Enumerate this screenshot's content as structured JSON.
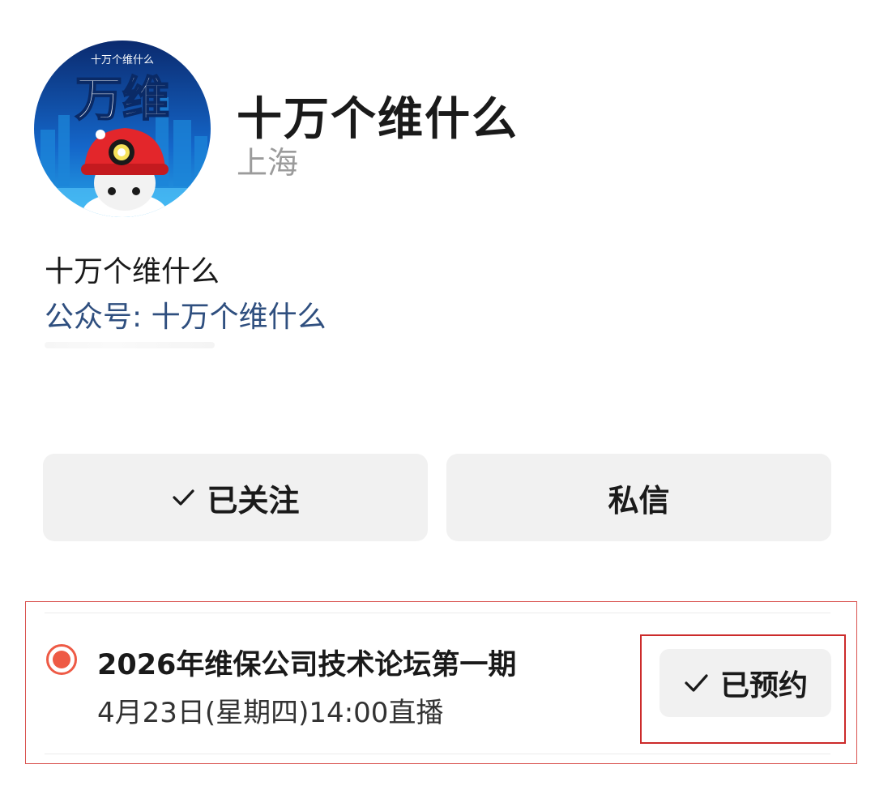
{
  "profile": {
    "avatar_icon": "cartoon-mascot-avatar",
    "avatar_text_top": "十万个维什么",
    "avatar_text_big": "万维",
    "name": "十万个维什么",
    "location": "上海"
  },
  "bio": {
    "text": "十万个维什么",
    "gzh_label": "公众号: 十万个维什么"
  },
  "actions": {
    "follow_label": "已关注",
    "follow_icon": "check-icon",
    "message_label": "私信"
  },
  "live": {
    "status_icon": "live-record-dot-icon",
    "title": "2026年维保公司技术论坛第一期",
    "time": "4月23日(星期四)14:00直播",
    "reserve_label": "已预约",
    "reserve_icon": "check-icon"
  },
  "colors": {
    "accent_red": "#ee5a45",
    "link_blue": "#2f4f7f",
    "button_bg": "#f1f1f1",
    "highlight_border": "#cc2b2b"
  }
}
